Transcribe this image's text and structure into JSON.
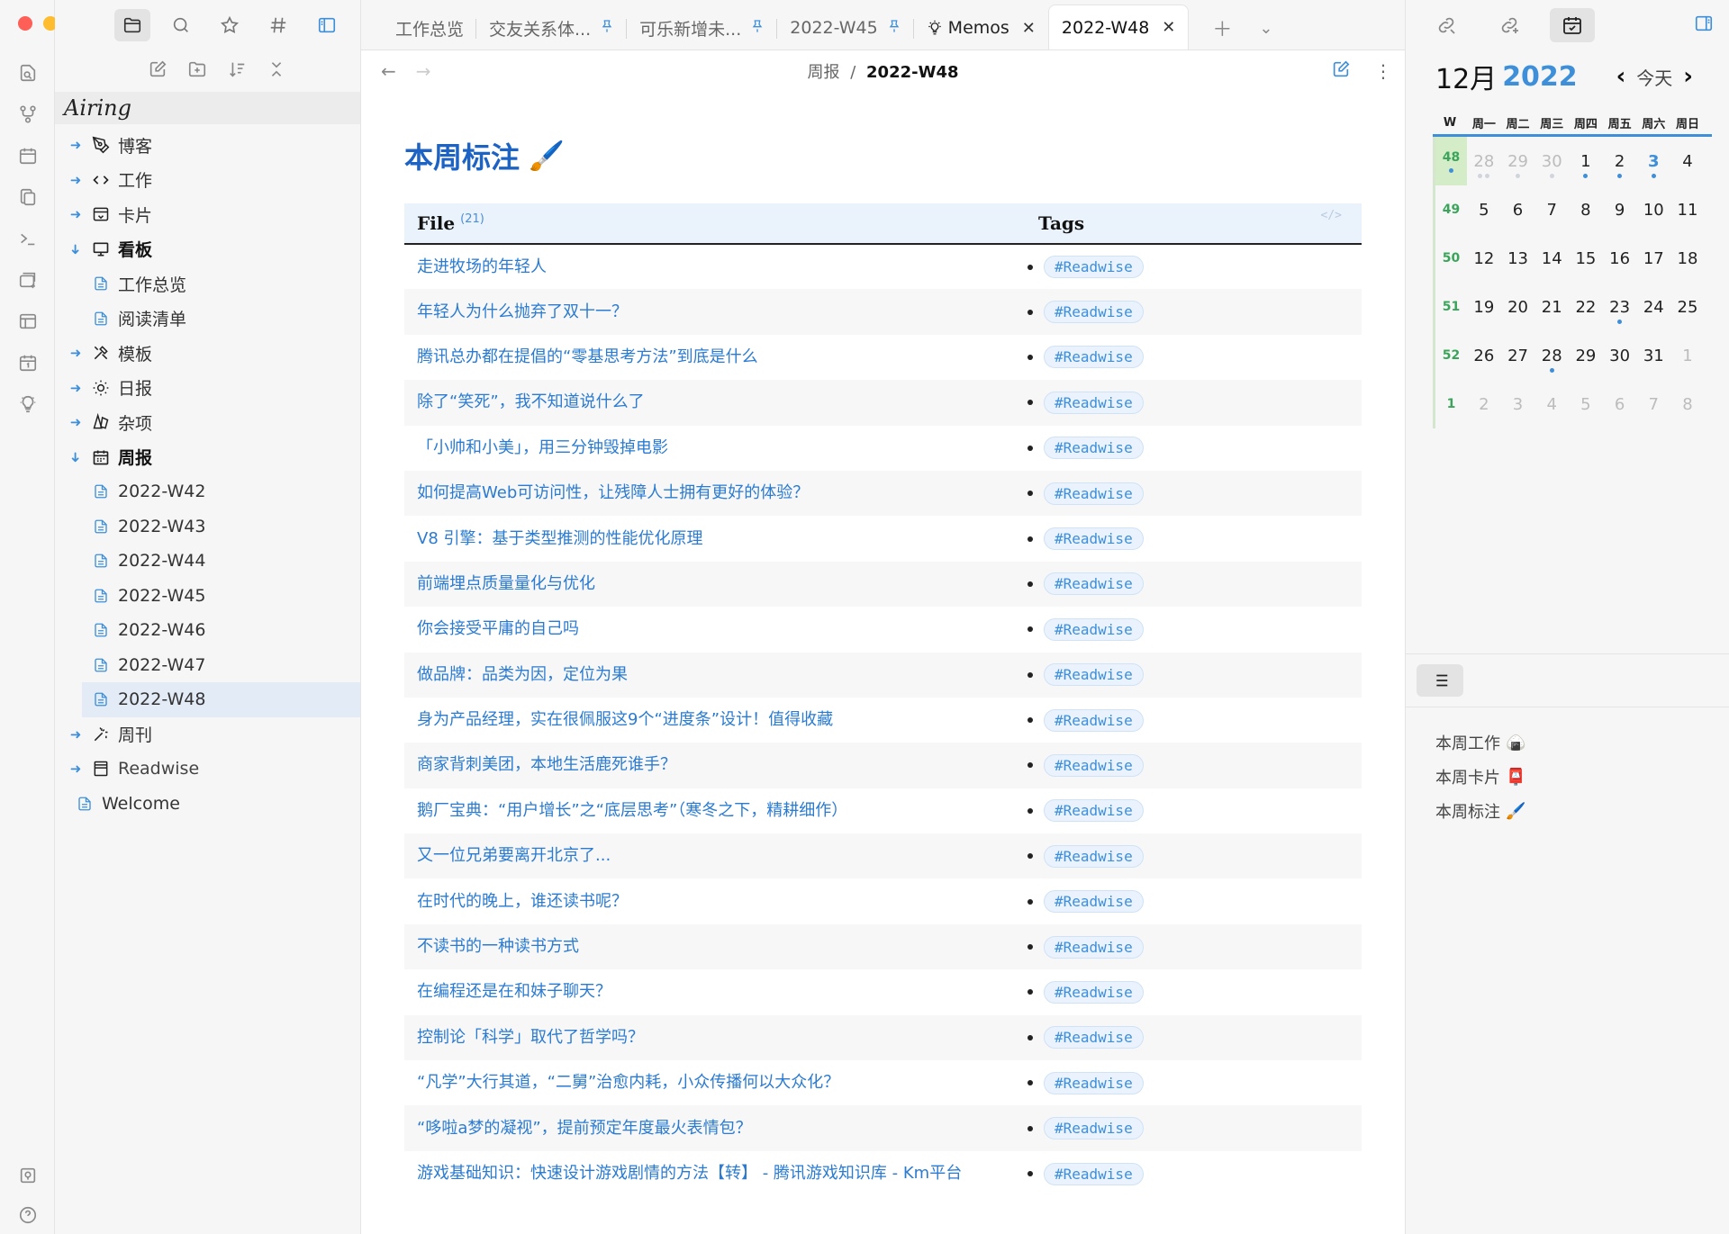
{
  "window": {
    "traffic_colors": [
      "#fe5f57",
      "#febc2e",
      "#28c840"
    ]
  },
  "sidebar": {
    "vault_name": "Airing",
    "items": [
      {
        "label": "博客",
        "icon": "pen-nib-icon",
        "expanded": false,
        "level": 0
      },
      {
        "label": "工作",
        "icon": "code-icon",
        "expanded": false,
        "level": 0
      },
      {
        "label": "卡片",
        "icon": "inbox-card-icon",
        "expanded": false,
        "level": 0
      },
      {
        "label": "看板",
        "icon": "monitor-icon",
        "expanded": true,
        "level": 0,
        "bold": true
      },
      {
        "label": "工作总览",
        "icon": "file-icon",
        "level": 1
      },
      {
        "label": "阅读清单",
        "icon": "file-icon",
        "level": 1
      },
      {
        "label": "模板",
        "icon": "tools-icon",
        "expanded": false,
        "level": 0
      },
      {
        "label": "日报",
        "icon": "sun-icon",
        "expanded": false,
        "level": 0
      },
      {
        "label": "杂项",
        "icon": "shapes-icon",
        "expanded": false,
        "level": 0
      },
      {
        "label": "周报",
        "icon": "calendar-icon",
        "expanded": true,
        "level": 0,
        "bold": true
      },
      {
        "label": "2022-W42",
        "icon": "file-icon",
        "level": 1
      },
      {
        "label": "2022-W43",
        "icon": "file-icon",
        "level": 1
      },
      {
        "label": "2022-W44",
        "icon": "file-icon",
        "level": 1
      },
      {
        "label": "2022-W45",
        "icon": "file-icon",
        "level": 1
      },
      {
        "label": "2022-W46",
        "icon": "file-icon",
        "level": 1
      },
      {
        "label": "2022-W47",
        "icon": "file-icon",
        "level": 1
      },
      {
        "label": "2022-W48",
        "icon": "file-icon",
        "level": 1,
        "selected": true
      },
      {
        "label": "周刊",
        "icon": "magic-icon",
        "expanded": false,
        "level": 0
      },
      {
        "label": "Readwise",
        "icon": "book-icon",
        "expanded": false,
        "level": 0
      },
      {
        "label": "Welcome",
        "icon": "file-icon",
        "level": 0,
        "leaf": true
      }
    ]
  },
  "tabs": [
    {
      "label": "工作总览",
      "pinned": false
    },
    {
      "label": "交友关系体...",
      "pinned": true
    },
    {
      "label": "可乐新增未...",
      "pinned": true
    },
    {
      "label": "2022-W45",
      "pinned": true
    },
    {
      "label": "Memos",
      "icon": "bulb-icon",
      "closable": true
    },
    {
      "label": "2022-W48",
      "closable": true,
      "active": true
    }
  ],
  "breadcrumb": {
    "parent": "周报",
    "sep": "/",
    "current": "2022-W48"
  },
  "note": {
    "heading": "本周标注",
    "heading_emoji": "🖌️",
    "table": {
      "col_file": "File",
      "count": "(21)",
      "col_tags": "Tags",
      "code_icon": "</>",
      "tag": "#Readwise",
      "rows": [
        "走进牧场的年轻人",
        "年轻人为什么抛弃了双十一？",
        "腾讯总办都在提倡的“零基思考方法”到底是什么",
        "除了“笑死”，我不知道说什么了",
        "「小帅和小美」，用三分钟毁掉电影",
        "如何提高Web可访问性，让残障人士拥有更好的体验？",
        "V8 引擎：基于类型推测的性能优化原理",
        "前端埋点质量量化与优化",
        "你会接受平庸的自己吗",
        "做品牌：品类为因，定位为果",
        "身为产品经理，实在很佩服这9个“进度条”设计！值得收藏",
        "商家背刺美团，本地生活鹿死谁手？",
        "鹅厂宝典：“用户增长”之“底层思考”（寒冬之下，精耕细作）",
        "又一位兄弟要离开北京了...",
        "在时代的晚上，谁还读书呢？",
        "不读书的一种读书方式",
        "在编程还是在和妹子聊天？",
        "控制论「科学」取代了哲学吗？",
        "“凡学”大行其道，“二舅”治愈内耗，小众传播何以大众化？",
        "“哆啦a梦的凝视”，提前预定年度最火表情包？",
        "游戏基础知识：快速设计游戏剧情的方法【转】 - 腾讯游戏知识库 - Km平台"
      ]
    }
  },
  "calendar": {
    "month": "12月",
    "year": "2022",
    "today_label": "今天",
    "week_header": "W",
    "dows": [
      "周一",
      "周二",
      "周三",
      "周四",
      "周五",
      "周六",
      "周日"
    ],
    "weeks": [
      {
        "w": "48",
        "days": [
          "28",
          "29",
          "30",
          "1",
          "2",
          "3",
          "4"
        ]
      },
      {
        "w": "49",
        "days": [
          "5",
          "6",
          "7",
          "8",
          "9",
          "10",
          "11"
        ]
      },
      {
        "w": "50",
        "days": [
          "12",
          "13",
          "14",
          "15",
          "16",
          "17",
          "18"
        ]
      },
      {
        "w": "51",
        "days": [
          "19",
          "20",
          "21",
          "22",
          "23",
          "24",
          "25"
        ]
      },
      {
        "w": "52",
        "days": [
          "26",
          "27",
          "28",
          "29",
          "30",
          "31",
          "1"
        ]
      },
      {
        "w": "1",
        "days": [
          "2",
          "3",
          "4",
          "5",
          "6",
          "7",
          "8"
        ]
      }
    ]
  },
  "outline": [
    {
      "label": "本周工作",
      "emoji": "🍙"
    },
    {
      "label": "本周卡片",
      "emoji": "📮"
    },
    {
      "label": "本周标注",
      "emoji": "🖌️"
    }
  ],
  "colors": {
    "accent": "#3d8fd9",
    "heading": "#1d63c4",
    "week_number": "#3aa55a"
  }
}
